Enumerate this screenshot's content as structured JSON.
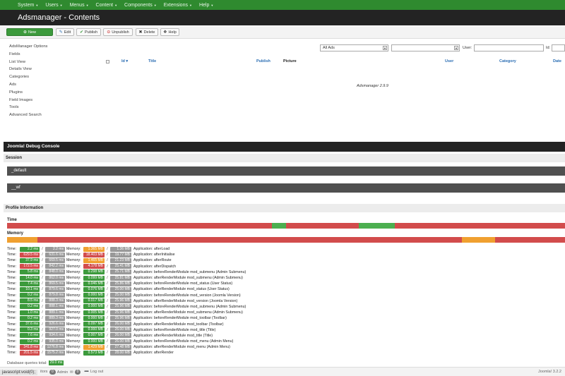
{
  "nav": {
    "items": [
      {
        "label": "System"
      },
      {
        "label": "Users"
      },
      {
        "label": "Menus"
      },
      {
        "label": "Content"
      },
      {
        "label": "Components"
      },
      {
        "label": "Extensions"
      },
      {
        "label": "Help"
      }
    ]
  },
  "header": {
    "title": "Adsmanager - Contents"
  },
  "toolbar": {
    "new_label": "New",
    "edit_label": "Edit",
    "publish_label": "Publish",
    "unpublish_label": "Unpublish",
    "delete_label": "Delete",
    "help_label": "Help"
  },
  "sidebar": {
    "items": [
      {
        "label": "AdsManager Options"
      },
      {
        "label": "Fields"
      },
      {
        "label": "List View"
      },
      {
        "label": "Details View"
      },
      {
        "label": "Categories"
      },
      {
        "label": "Ads"
      },
      {
        "label": "Plugins"
      },
      {
        "label": "Field Images"
      },
      {
        "label": "Tools"
      },
      {
        "label": "Advanced Search"
      }
    ]
  },
  "filters": {
    "ads_select_value": "All Ads",
    "second_select_value": "",
    "user_label": "User:",
    "id_label": "Id:"
  },
  "table": {
    "columns": {
      "id": "Id",
      "title": "Title",
      "publish": "Publish",
      "picture": "Picture",
      "user": "User",
      "category": "Category",
      "date": "Date"
    }
  },
  "version_text": "Adsmanager 2.9.9",
  "debug": {
    "title": "Joomla! Debug Console",
    "session_label": "Session",
    "session_items": [
      "_default",
      "__wf"
    ],
    "profile_label": "Profile Information",
    "time_label": "Time",
    "memory_label": "Memory",
    "time_bar": [
      {
        "pct": 47.5,
        "color": "#d24c4c"
      },
      {
        "pct": 2.5,
        "color": "#4caf50"
      },
      {
        "pct": 13,
        "color": "#d24c4c"
      },
      {
        "pct": 6.5,
        "color": "#4caf50"
      },
      {
        "pct": 30.5,
        "color": "#d24c4c"
      }
    ],
    "memory_bar": [
      {
        "pct": 5.5,
        "color": "#f0a030"
      },
      {
        "pct": 76,
        "color": "#d24c4c"
      },
      {
        "pct": 6,
        "color": "#f0a030"
      },
      {
        "pct": 12.5,
        "color": "#d24c4c"
      }
    ],
    "row_labels": {
      "time": "Time:",
      "memory": "Memory:"
    },
    "rows": [
      {
        "time": "2.2 ms",
        "tc": "green",
        "total": "2.2 ms",
        "mem": "1.365 MB",
        "mc": "orange",
        "memtot": "1.36 MB",
        "msg": "Application: afterLoad"
      },
      {
        "time": "629.5 ms",
        "tc": "red",
        "total": "631.6 ms",
        "mem": "18.403 MB",
        "mc": "red",
        "memtot": "19.77 MB",
        "msg": "Application: afterInitialise"
      },
      {
        "time": "37.9 ms",
        "tc": "green",
        "total": "669.5 ms",
        "mem": "1.465 MB",
        "mc": "orange",
        "memtot": "21.23 MB",
        "msg": "Application: afterRoute"
      },
      {
        "time": "172.5 ms",
        "tc": "red",
        "total": "842.2 ms",
        "mem": "4.178 MB",
        "mc": "red",
        "memtot": "25.41 MB",
        "msg": "Application: afterDispatch"
      },
      {
        "time": "5.8 ms",
        "tc": "green",
        "total": "848.0 ms",
        "mem": "0.298 MB",
        "mc": "green",
        "memtot": "25.71 MB",
        "msg": "Application: beforeRenderModule mod_submenu (Admin Submenu)"
      },
      {
        "time": "14.0 ms",
        "tc": "green",
        "total": "862.0 ms",
        "mem": "0.099 MB",
        "mc": "green",
        "memtot": "25.81 MB",
        "msg": "Application: afterRenderModule mod_submenu (Admin Submenu)"
      },
      {
        "time": "7.4 ms",
        "tc": "green",
        "total": "869.5 ms",
        "mem": "0.046 MB",
        "mc": "green",
        "memtot": "25.86 MB",
        "msg": "Application: beforeRenderModule mod_status (User Status)"
      },
      {
        "time": "10.1 ms",
        "tc": "green",
        "total": "879.6 ms",
        "mem": "0.076 MB",
        "mc": "green",
        "memtot": "25.00 MB",
        "msg": "Application: afterRenderModule mod_status (User Status)"
      },
      {
        "time": "0.2 ms",
        "tc": "green",
        "total": "879.8 ms",
        "mem": "0.000 MB",
        "mc": "green",
        "memtot": "25.00 MB",
        "msg": "Application: beforeRenderModule mod_version (Joomla Version)"
      },
      {
        "time": "8.5 ms",
        "tc": "green",
        "total": "888.3 ms",
        "mem": "0.017 MB",
        "mc": "green",
        "memtot": "25.96 MB",
        "msg": "Application: afterRenderModule mod_version (Joomla Version)"
      },
      {
        "time": "0.2 ms",
        "tc": "green",
        "total": "888.1 ms",
        "mem": "0.000 MB",
        "mc": "green",
        "memtot": "25.96 MB",
        "msg": "Application: beforeRenderModule mod_submenu (Admin Submenu)"
      },
      {
        "time": "1.0 ms",
        "tc": "green",
        "total": "889.1 ms",
        "mem": "0.005 MB",
        "mc": "green",
        "memtot": "25.96 MB",
        "msg": "Application: afterRenderModule mod_submenu (Admin Submenu)"
      },
      {
        "time": "0.2 ms",
        "tc": "green",
        "total": "889.3 ms",
        "mem": "0.000 MB",
        "mc": "green",
        "memtot": "25.96 MB",
        "msg": "Application: beforeRenderModule mod_toolbar (Toolbar)"
      },
      {
        "time": "37.6 ms",
        "tc": "green",
        "total": "926.6 ms",
        "mem": "0.097 MB",
        "mc": "green",
        "memtot": "26.00 MB",
        "msg": "Application: afterRenderModule mod_toolbar (Toolbar)"
      },
      {
        "time": "0.3 ms",
        "tc": "green",
        "total": "927.0 ms",
        "mem": "0.000 MB",
        "mc": "green",
        "memtot": "26.00 MB",
        "msg": "Application: beforeRenderModule mod_title (Title)"
      },
      {
        "time": "7.6 ms",
        "tc": "green",
        "total": "934.6 ms",
        "mem": "0.007 MB",
        "mc": "green",
        "memtot": "26.00 MB",
        "msg": "Application: afterRenderModule mod_title (Title)"
      },
      {
        "time": "0.2 ms",
        "tc": "green",
        "total": "935.0 ms",
        "mem": "0.000 MB",
        "mc": "green",
        "memtot": "26.00 MB",
        "msg": "Application: beforeRenderModule mod_menu (Admin Menu)"
      },
      {
        "time": "341.8 ms",
        "tc": "red",
        "total": "1276.8 ms",
        "mem": "1.429 MB",
        "mc": "orange",
        "memtot": "27.48 MB",
        "msg": "Application: afterRenderModule mod_menu (Admin Menu)"
      },
      {
        "time": "201.5 ms",
        "tc": "red",
        "total": "1575.2 ms",
        "mem": "0.573 MB",
        "mc": "green",
        "memtot": "28.00 MB",
        "msg": "Application: afterRender"
      }
    ],
    "db_queries_label": "Database queries total:",
    "db_queries_value": "29.0 ms"
  },
  "footer": {
    "status_url": "javascript:void(0);",
    "visitors_label": "itors",
    "visitors_count": "0",
    "admin_label": "Admin",
    "messages_count": "0",
    "logout_label": "Log out",
    "version": "Joomla! 3.2.2"
  }
}
